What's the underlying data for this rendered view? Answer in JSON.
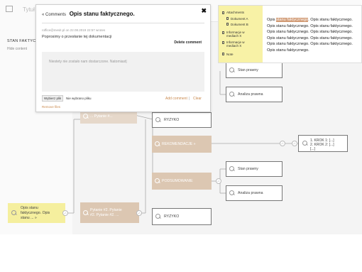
{
  "background": {
    "page_title": "Tytuł",
    "left_title": "STAN FAKTYCZ...",
    "left_hide": "Hide content"
  },
  "comments": {
    "back_label": "« Comments",
    "title": "Opis stanu faktycznego.",
    "close_label": "✖",
    "meta": "roffice@mesit.pl on 22.08.2019 22:57 wrotes",
    "message": "Poprosimy o przesłanie tej dokumentacji",
    "delete_label": "Delete comment",
    "textarea_value": "Niestety nie zostało nam dostarczone. Natomiast|",
    "file_button": "Wybierz plik",
    "file_status": "Nie wybrano pliku",
    "add_label": "Add comment",
    "divider": "|",
    "clear_label": "Clear",
    "remove_files": "Remove files"
  },
  "attachments": {
    "header": "Attachments",
    "doc_a": "Dokument A",
    "doc_b": "Dokument B",
    "info1_line1": "Informacje w",
    "info1_line2": "mediach X",
    "info2_line1": "Informacje w",
    "info2_line2": "mediach X",
    "note": "Note",
    "text_before": "Opis ",
    "text_highlight": "stanu faktycznego",
    "text_after": ". Opis stanu faktycznego. Opis stanu faktycznego. Opis stanu faktycznego. Opis stanu faktycznego. Opis stanu faktycznego. Opis stanu faktycznego. Opis stanu faktycznego. Opis stanu faktycznego. Opis stanu faktycznego. Opis stanu faktycznego."
  },
  "nodes": {
    "stan_prawny_top": "Stan prawny",
    "analiza_prawna_top": "Analiza prawna",
    "pytanie_top": "... Pytanie #...",
    "ryzyko_top": "RYZYKO",
    "rekomendacje": "REKOMENDACJE »",
    "krok_1": "1. KROK 1: [...]",
    "krok_2": "2. KROK 2: [...]",
    "krok_more": "[...]",
    "stan_prawny_mid": "Stan prawny",
    "podsumowanie": "PODSUMOWANIE",
    "analiza_prawna_mid": "Analiza prawna",
    "root_line1": "Opis stanu",
    "root_line2": "faktycznego. Opis",
    "root_line3": "stanu ... »",
    "pytanie_bottom_line1": "Pytanie #2. Pytanie",
    "pytanie_bottom_line2": "#2. Pytanie #2. ...",
    "ryzyko_bottom": "RYZYKO",
    "circle_marker": "-/-"
  },
  "colors": {
    "beige": "#dcc7b2",
    "yellow": "#f5ef9e",
    "accent": "#c9894d",
    "highlight": "#d19a74"
  }
}
